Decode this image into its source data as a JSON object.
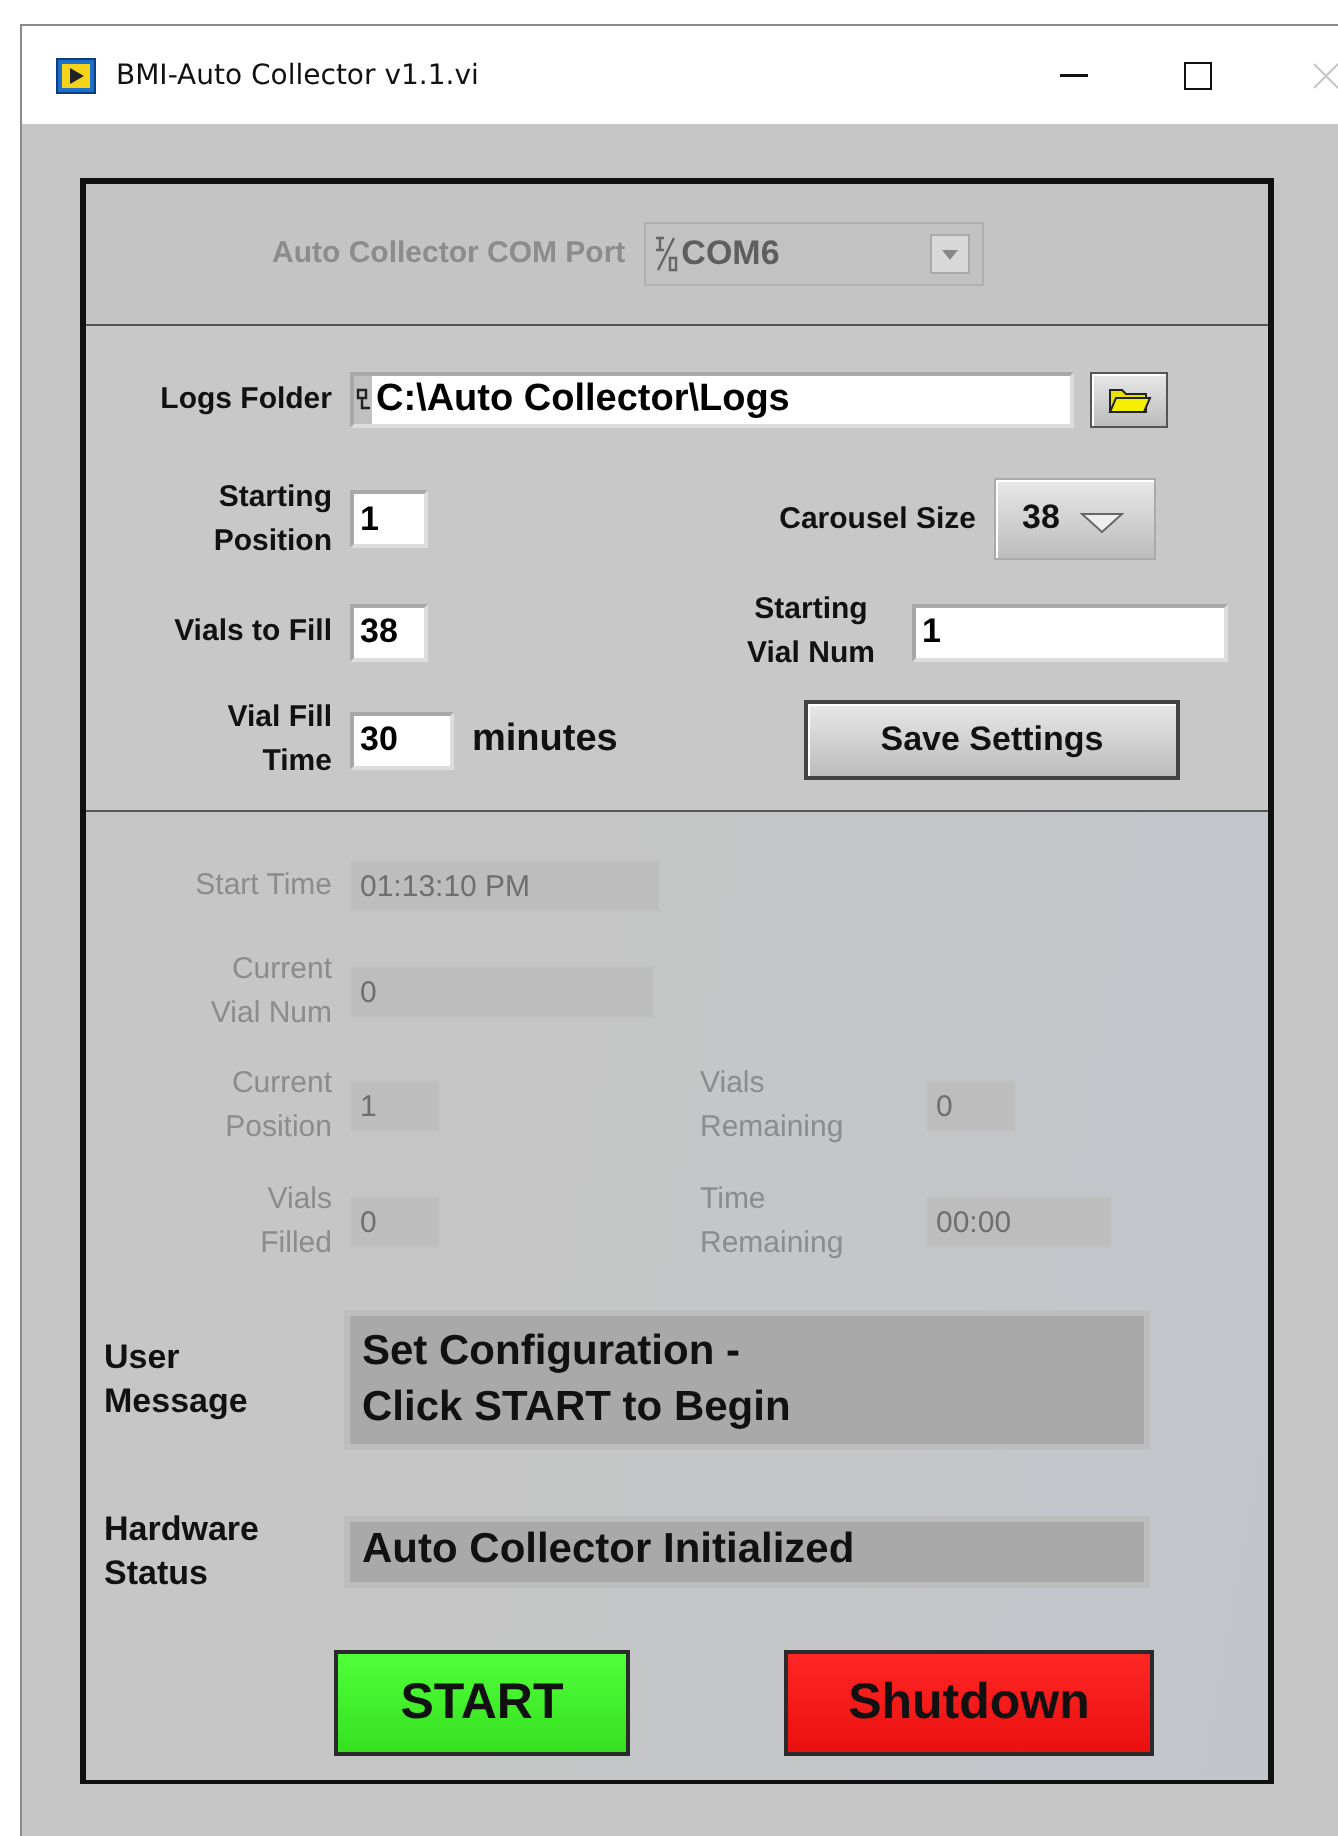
{
  "window": {
    "title": "BMI-Auto Collector v1.1.vi",
    "close_disabled": true
  },
  "com_port": {
    "label": "Auto Collector COM Port",
    "value": "COM6",
    "disabled": true
  },
  "settings": {
    "logs_folder": {
      "label": "Logs Folder",
      "value": "C:\\Auto Collector\\Logs"
    },
    "starting_position": {
      "label": "Starting\nPosition",
      "value": "1"
    },
    "carousel_size": {
      "label": "Carousel Size",
      "value": "38"
    },
    "vials_to_fill": {
      "label": "Vials to Fill",
      "value": "38"
    },
    "starting_vial_num": {
      "label": "Starting\nVial Num",
      "value": "1"
    },
    "vial_fill_time": {
      "label": "Vial Fill\nTime",
      "value": "30",
      "unit": "minutes"
    },
    "save_button": "Save Settings"
  },
  "status": {
    "disabled": true,
    "start_time": {
      "label": "Start Time",
      "value": "01:13:10 PM"
    },
    "current_vial_num": {
      "label": "Current\nVial Num",
      "value": "0"
    },
    "current_position": {
      "label": "Current\nPosition",
      "value": "1"
    },
    "vials_remaining": {
      "label": "Vials\nRemaining",
      "value": "0"
    },
    "vials_filled": {
      "label": "Vials\nFilled",
      "value": "0"
    },
    "time_remaining": {
      "label": "Time\nRemaining",
      "value": "00:00"
    }
  },
  "user_message": {
    "label": "User\nMessage",
    "value": "Set Configuration -\nClick START to Begin"
  },
  "hardware_status": {
    "label": "Hardware\nStatus",
    "value": "Auto Collector Initialized"
  },
  "buttons": [
    {
      "label": "START",
      "kind": "start"
    },
    {
      "label": "Shutdown",
      "kind": "shutdown"
    }
  ]
}
